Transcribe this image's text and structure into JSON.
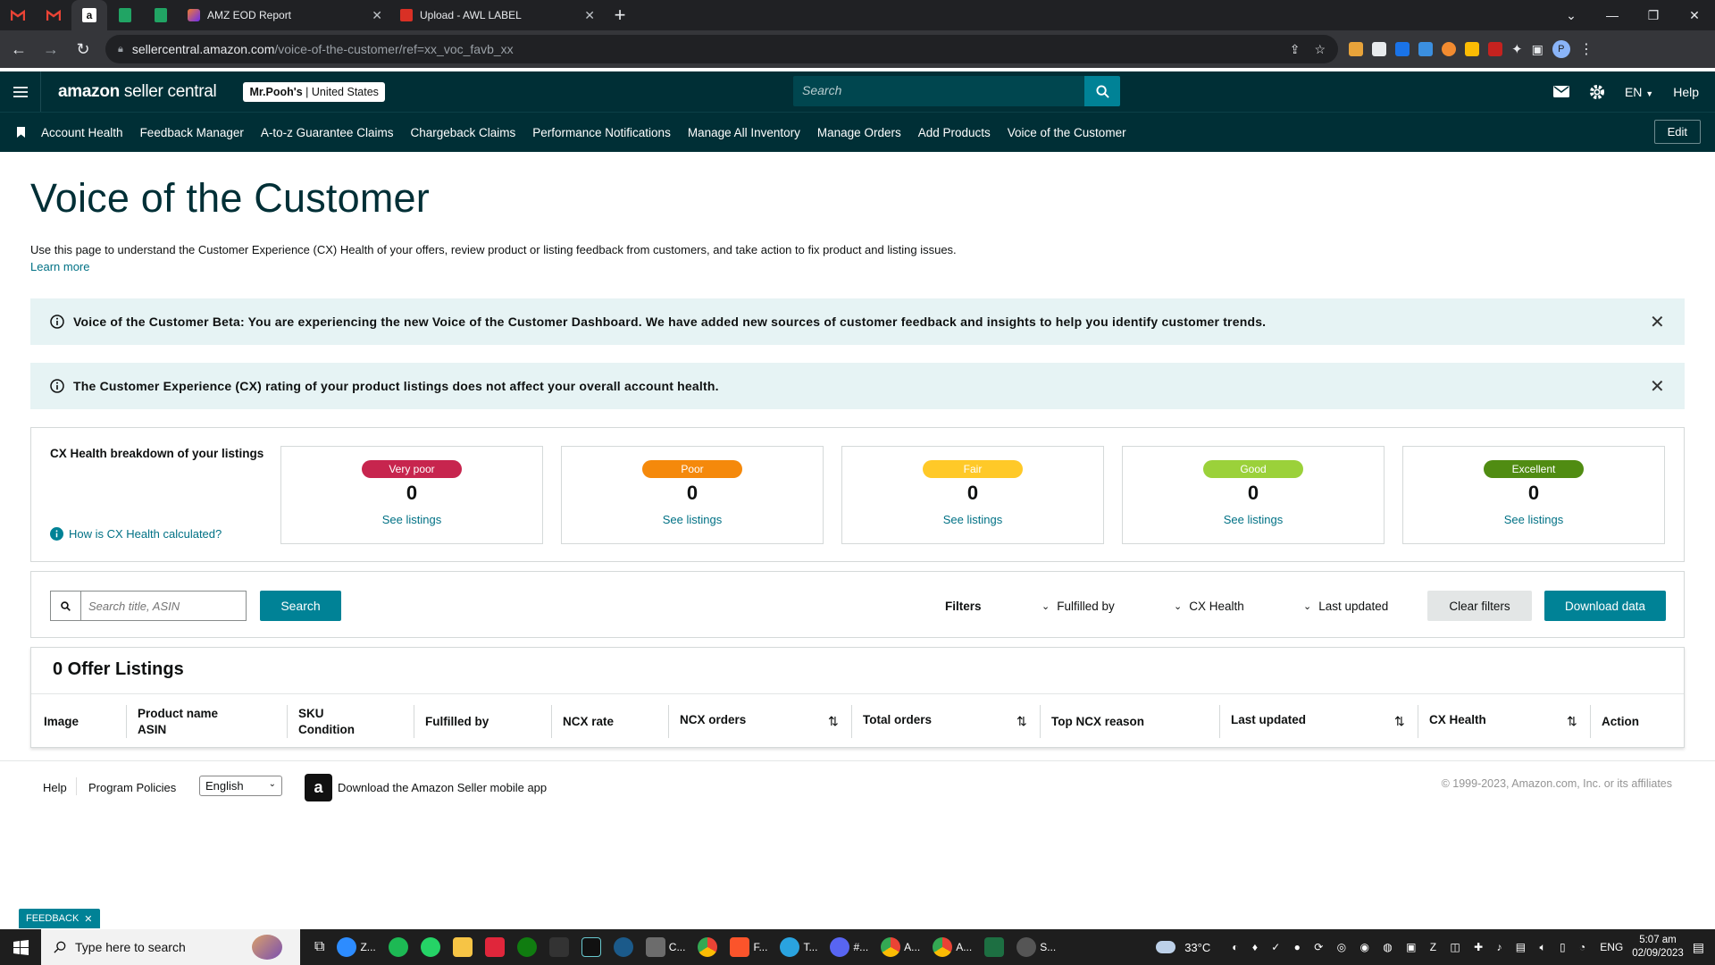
{
  "browser": {
    "tabs": [
      {
        "title": "AMZ EOD Report"
      },
      {
        "title": "Upload - AWL LABEL"
      }
    ],
    "url_host": "sellercentral.amazon.com",
    "url_path": "/voice-of-the-customer/ref=xx_voc_favb_xx"
  },
  "header": {
    "logo_brand": "amazon",
    "logo_product": " seller central",
    "account_name": "Mr.Pooh's",
    "account_region": " | United States",
    "search_placeholder": "Search",
    "language": "EN",
    "help": "Help"
  },
  "nav": {
    "links": [
      "Account Health",
      "Feedback Manager",
      "A-to-z Guarantee Claims",
      "Chargeback Claims",
      "Performance Notifications",
      "Manage All Inventory",
      "Manage Orders",
      "Add Products",
      "Voice of the Customer"
    ],
    "edit": "Edit"
  },
  "page": {
    "title": "Voice of the Customer",
    "description": "Use this page to understand the Customer Experience (CX) Health of your offers, review product or listing feedback from customers, and take action to fix product and listing issues.",
    "learn_more": "Learn more",
    "alerts": [
      "Voice of the Customer Beta: You are experiencing the new Voice of the Customer Dashboard. We have added new sources of customer feedback and insights to help you identify customer trends.",
      "The Customer Experience (CX) rating of your product listings does not affect your overall account health."
    ]
  },
  "cx_health": {
    "label": "CX Health breakdown of your listings",
    "how_link": "How is CX Health calculated?",
    "cards": [
      {
        "label": "Very poor",
        "count": "0",
        "link": "See listings",
        "color": "#c7254e"
      },
      {
        "label": "Poor",
        "count": "0",
        "link": "See listings",
        "color": "#f5890b"
      },
      {
        "label": "Fair",
        "count": "0",
        "link": "See listings",
        "color": "#ffc928"
      },
      {
        "label": "Good",
        "count": "0",
        "link": "See listings",
        "color": "#9bd13a"
      },
      {
        "label": "Excellent",
        "count": "0",
        "link": "See listings",
        "color": "#508c12"
      }
    ]
  },
  "filters": {
    "search_placeholder": "Search title, ASIN",
    "search_button": "Search",
    "label": "Filters",
    "fulfilled_by": "Fulfilled by",
    "cx_health": "CX Health",
    "last_updated": "Last updated",
    "clear": "Clear filters",
    "download": "Download data"
  },
  "offers": {
    "title": "0 Offer Listings",
    "columns": [
      {
        "line1": "Image",
        "line2": ""
      },
      {
        "line1": "Product name",
        "line2": "ASIN"
      },
      {
        "line1": "SKU",
        "line2": "Condition"
      },
      {
        "line1": "Fulfilled by",
        "line2": ""
      },
      {
        "line1": "NCX rate",
        "line2": ""
      },
      {
        "line1": "NCX orders",
        "line2": ""
      },
      {
        "line1": "Total orders",
        "line2": ""
      },
      {
        "line1": "Top NCX reason",
        "line2": ""
      },
      {
        "line1": "Last updated",
        "line2": ""
      },
      {
        "line1": "CX Health",
        "line2": ""
      },
      {
        "line1": "Action",
        "line2": ""
      }
    ]
  },
  "footer": {
    "help": "Help",
    "policies": "Program Policies",
    "language": "English",
    "app": "Download the Amazon Seller mobile app",
    "copyright": "© 1999-2023, Amazon.com, Inc. or its affiliates",
    "feedback": "FEEDBACK"
  },
  "taskbar": {
    "search": "Type here to search",
    "temp": "33°C",
    "lang": "ENG",
    "time": "5:07 am",
    "date": "02/09/2023"
  }
}
